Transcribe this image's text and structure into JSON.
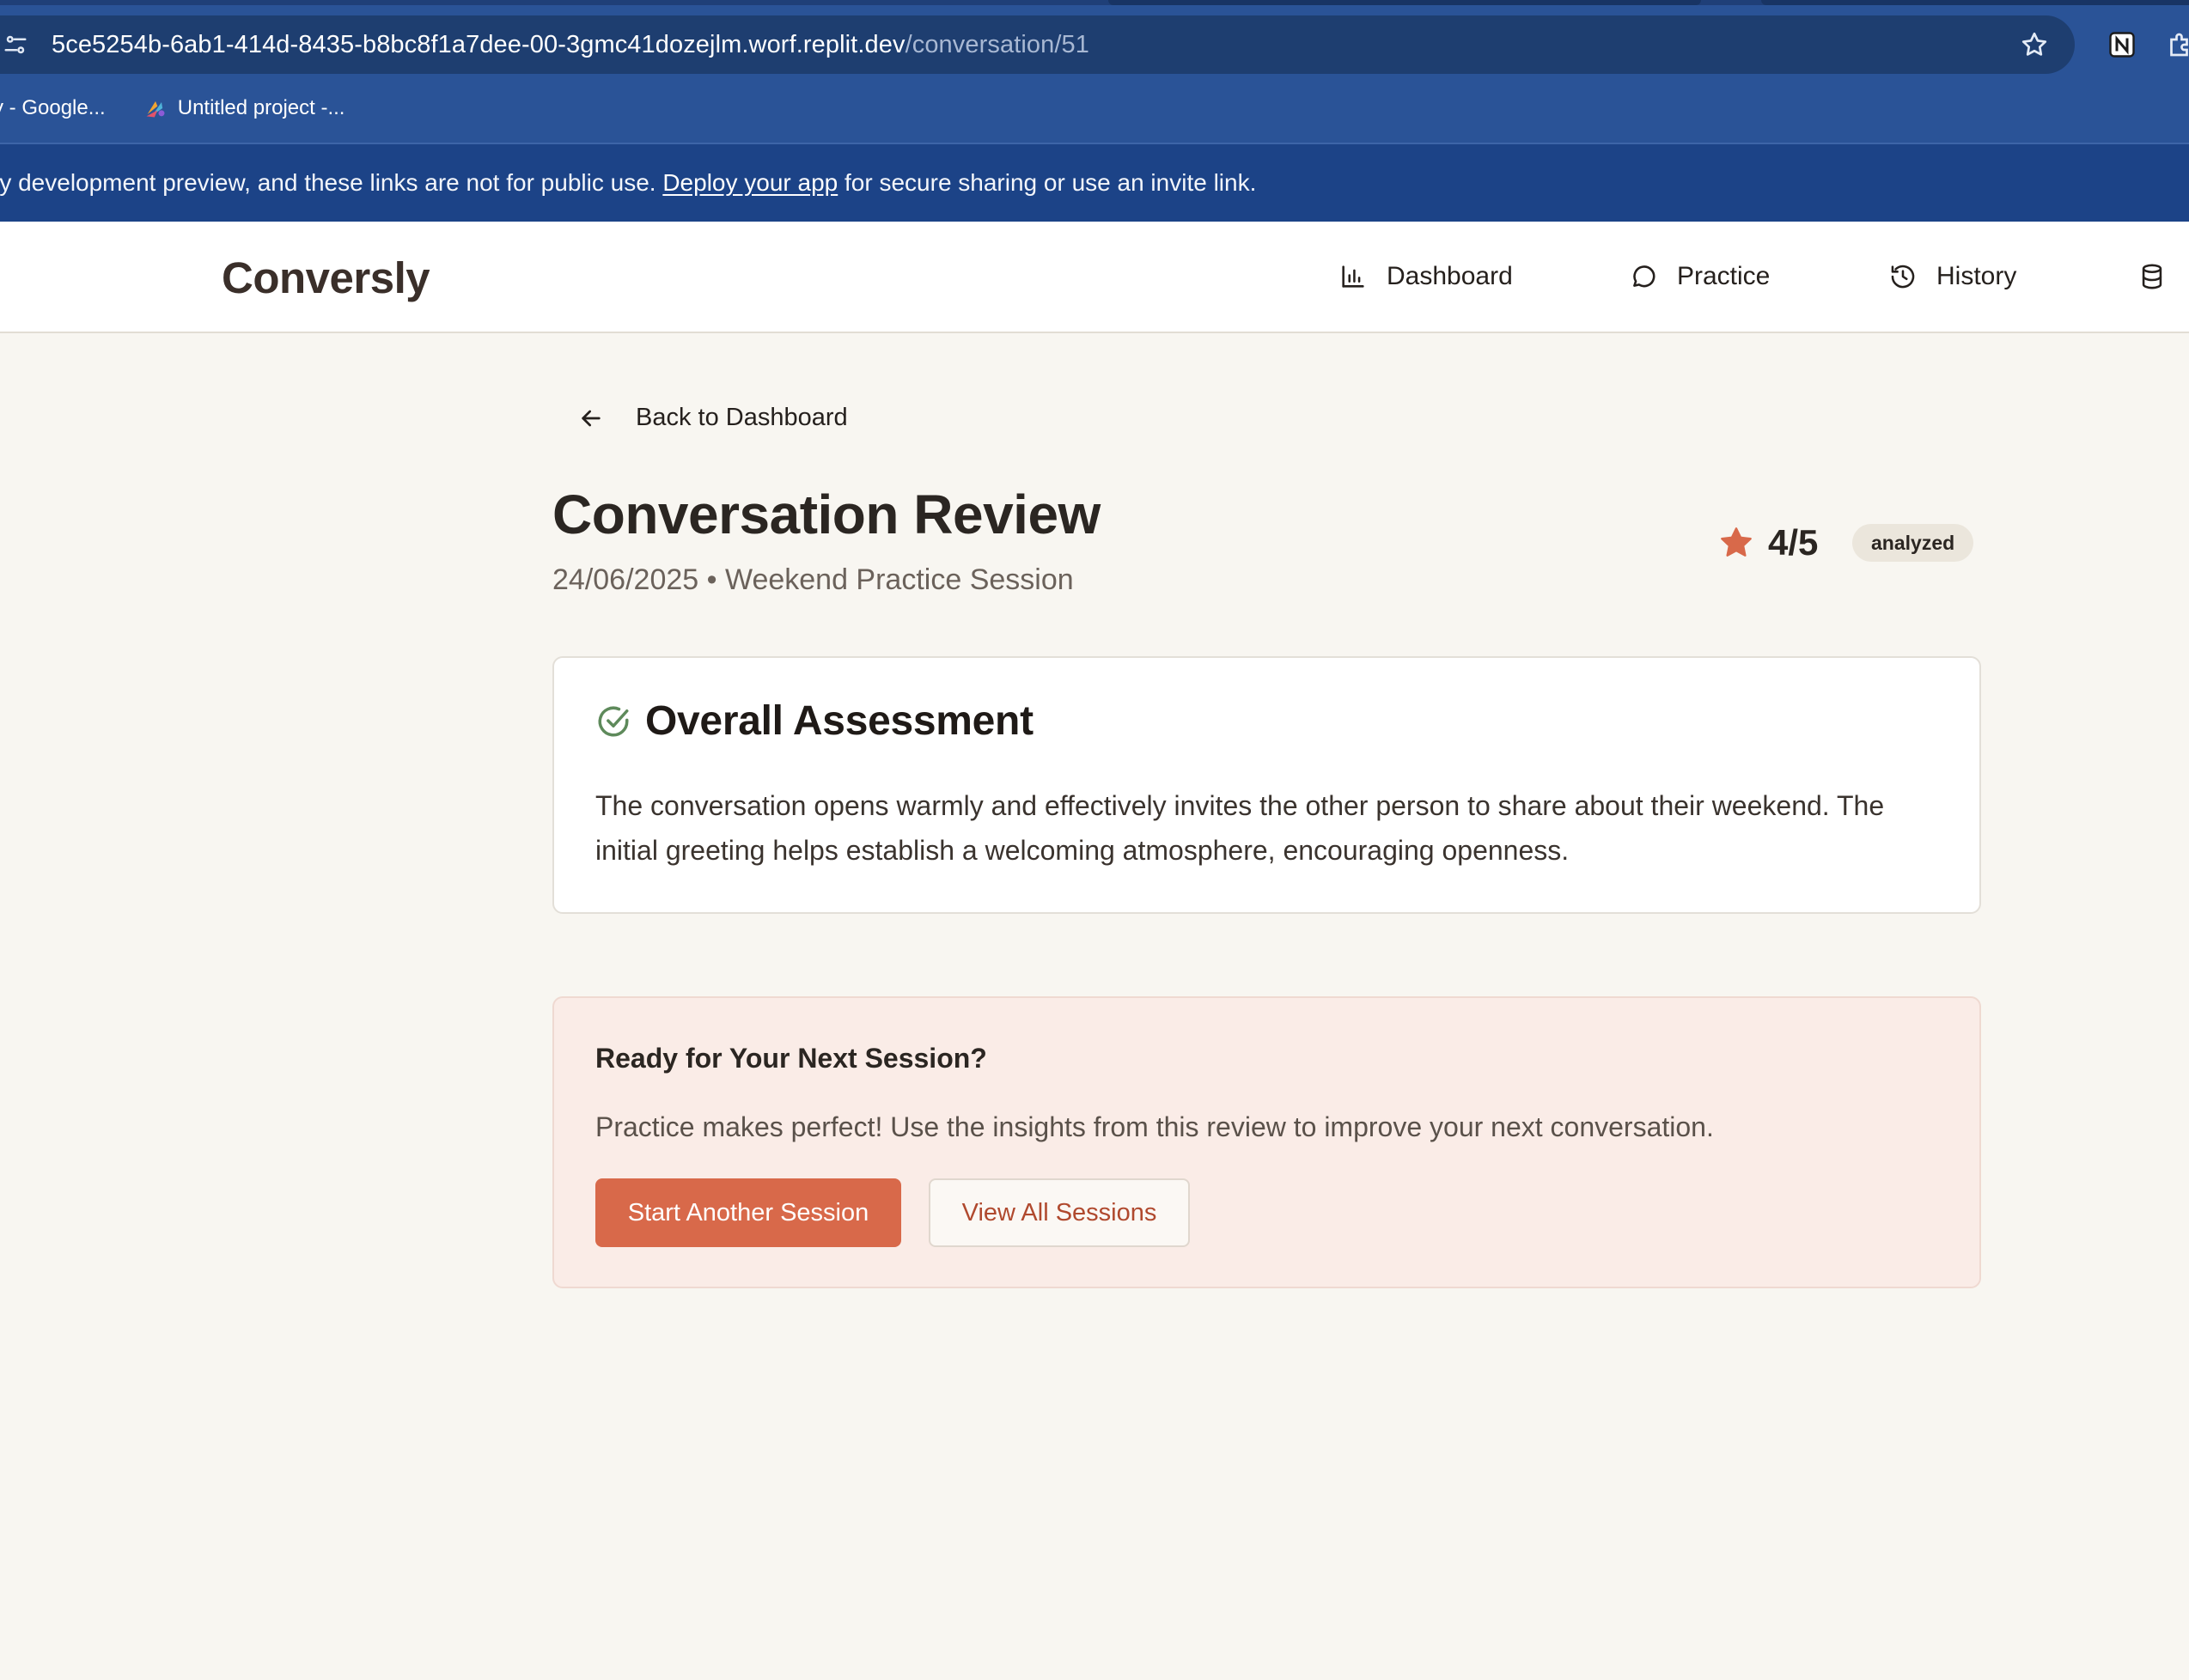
{
  "browser": {
    "url_host": "5ce5254b-6ab1-414d-8435-b8bc8f1a7dee-00-3gmc41dozejlm.worf.replit.dev",
    "url_path": "/conversation/51",
    "bookmarks": [
      {
        "label": "y - Google..."
      },
      {
        "label": "Untitled project -..."
      }
    ],
    "banner": {
      "text_before": "ry development preview, and these links are not for public use.",
      "link": "Deploy your app",
      "text_after": "for secure sharing or use an invite link."
    }
  },
  "app": {
    "logo": "Conversly",
    "nav": [
      {
        "label": "Dashboard",
        "icon": "bar-chart-icon"
      },
      {
        "label": "Practice",
        "icon": "message-circle-icon"
      },
      {
        "label": "History",
        "icon": "history-icon"
      },
      {
        "label": "",
        "icon": "database-icon"
      }
    ]
  },
  "review": {
    "back_label": "Back to Dashboard",
    "title": "Conversation Review",
    "meta": "24/06/2025 • Weekend Practice Session",
    "score": "4/5",
    "status": "analyzed",
    "assessment": {
      "title": "Overall Assessment",
      "body": "The conversation opens warmly and effectively invites the other person to share about their weekend. The initial greeting helps establish a welcoming atmosphere, encouraging openness."
    },
    "cta": {
      "title": "Ready for Your Next Session?",
      "text": "Practice makes perfect! Use the insights from this review to improve your next conversation.",
      "primary_button": "Start Another Session",
      "secondary_button": "View All Sessions"
    }
  },
  "colors": {
    "chrome": "#2a5397",
    "banner": "#1c4387",
    "accent": "#d8694a",
    "background": "#f8f6f1",
    "check": "#5e8a5b"
  }
}
